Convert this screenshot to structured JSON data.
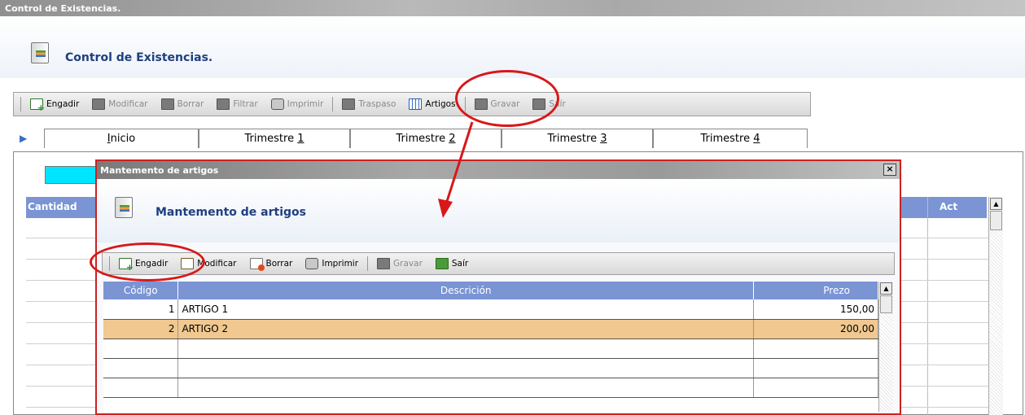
{
  "main": {
    "title": "Control de Existencias.",
    "header_title": "Control de Existencias.",
    "toolbar": [
      {
        "label": "Engadir",
        "icon": "add-doc-icon",
        "enabled": true
      },
      {
        "label": "Modificar",
        "icon": "modify-icon",
        "enabled": false
      },
      {
        "label": "Borrar",
        "icon": "delete-icon",
        "enabled": false
      },
      {
        "label": "Filtrar",
        "icon": "filter-icon",
        "enabled": false
      },
      {
        "label": "Imprimir",
        "icon": "printer-icon",
        "enabled": false
      },
      {
        "label": "Traspaso",
        "icon": "transfer-icon",
        "enabled": false
      },
      {
        "label": "Artigos",
        "icon": "grid-icon",
        "enabled": true
      },
      {
        "label": "Gravar",
        "icon": "save-icon",
        "enabled": false
      },
      {
        "label": "Saír",
        "icon": "exit-icon",
        "enabled": false
      }
    ],
    "tabs": [
      {
        "prefix": "",
        "key": "I",
        "suffix": "nicio"
      },
      {
        "prefix": "Trimestre ",
        "key": "1",
        "suffix": ""
      },
      {
        "prefix": "Trimestre ",
        "key": "2",
        "suffix": ""
      },
      {
        "prefix": "Trimestre ",
        "key": "3",
        "suffix": ""
      },
      {
        "prefix": "Trimestre ",
        "key": "4",
        "suffix": ""
      }
    ],
    "grid_columns": [
      "Cantidad",
      "Act"
    ],
    "accent": "#00e5ff"
  },
  "dialog": {
    "title": "Mantemento de artigos",
    "close_label": "×",
    "header_title": "Mantemento de artigos",
    "toolbar": [
      {
        "label": "Engadir",
        "icon": "add-doc-icon",
        "enabled": true
      },
      {
        "label": "Modificar",
        "icon": "modify-icon",
        "enabled": true
      },
      {
        "label": "Borrar",
        "icon": "delete-icon",
        "enabled": true
      },
      {
        "label": "Imprimir",
        "icon": "printer-icon",
        "enabled": true
      },
      {
        "label": "Gravar",
        "icon": "save-icon",
        "enabled": false
      },
      {
        "label": "Saír",
        "icon": "exit-icon",
        "enabled": true
      }
    ],
    "columns": [
      "Código",
      "Descrición",
      "Prezo"
    ],
    "rows": [
      {
        "code": "1",
        "desc": "ARTIGO 1",
        "price": "150,00",
        "selected": false
      },
      {
        "code": "2",
        "desc": "ARTIGO 2",
        "price": "200,00",
        "selected": true
      }
    ],
    "empty_rows": 3,
    "selection_color": "#f0c890",
    "header_color": "#7a94d4"
  },
  "annotations": {
    "color": "#d81818"
  }
}
